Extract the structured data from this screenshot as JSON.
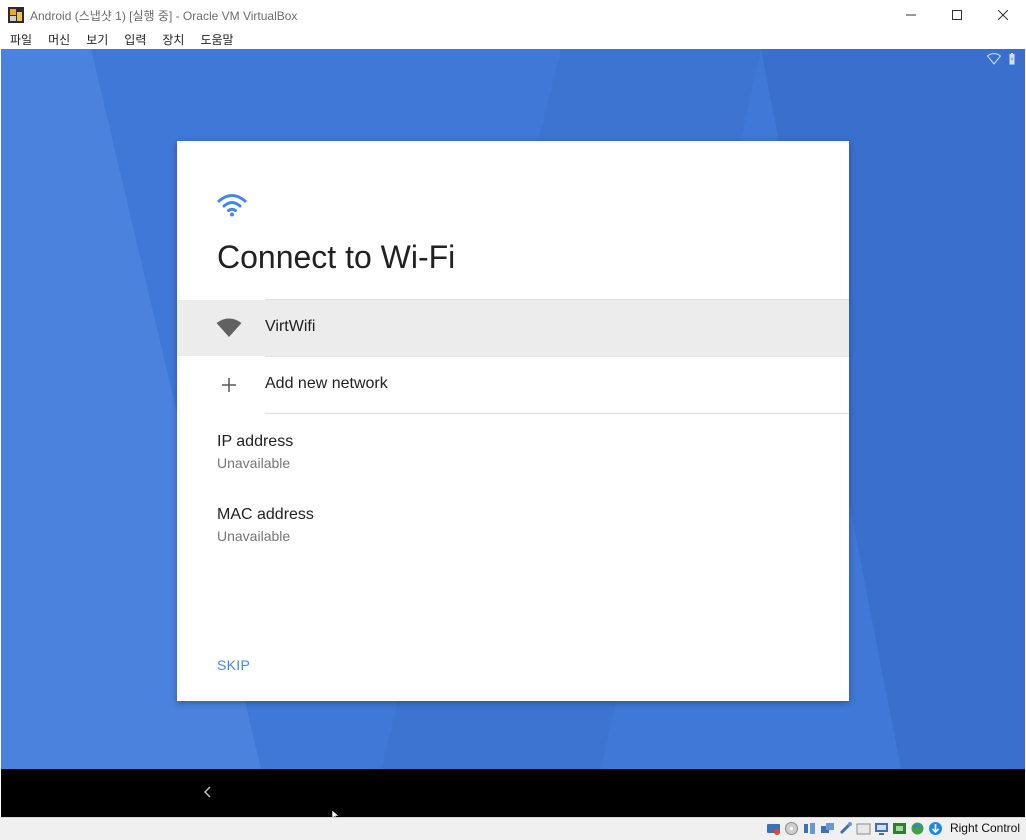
{
  "window": {
    "title": "Android (스냅샷 1) [실행 중] - Oracle VM VirtualBox"
  },
  "menu": {
    "items": [
      {
        "label": "파일"
      },
      {
        "label": "머신"
      },
      {
        "label": "보기"
      },
      {
        "label": "입력"
      },
      {
        "label": "장치"
      },
      {
        "label": "도움말"
      }
    ]
  },
  "setup": {
    "title": "Connect to Wi-Fi",
    "networks": [
      {
        "label": "VirtWifi",
        "icon": "wifi-signal-icon",
        "selected": true
      },
      {
        "label": "Add new network",
        "icon": "plus-icon"
      }
    ],
    "ip": {
      "label": "IP address",
      "value": "Unavailable"
    },
    "mac": {
      "label": "MAC address",
      "value": "Unavailable"
    },
    "skip_label": "SKIP"
  },
  "host_status": {
    "host_key": "Right Control"
  },
  "colors": {
    "background": "#3f78d6",
    "accent": "#4285f4",
    "selected_row": "#ececec"
  }
}
